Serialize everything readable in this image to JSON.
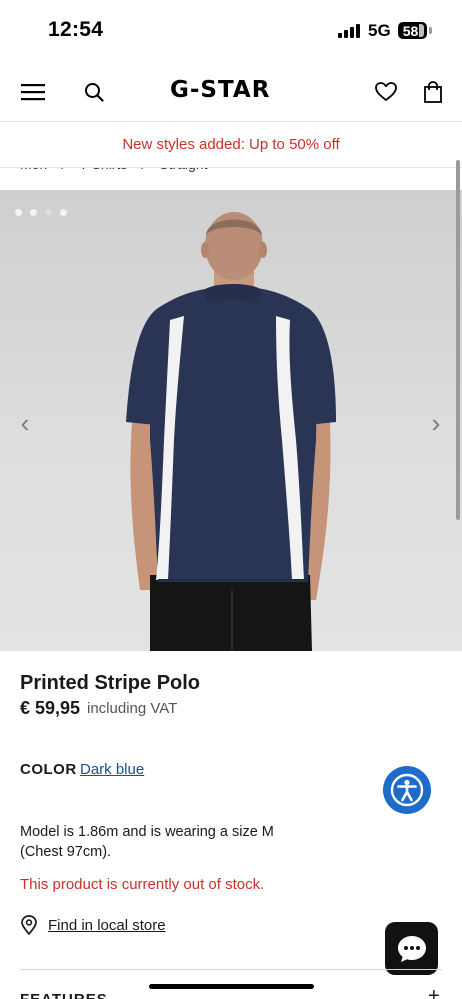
{
  "status_bar": {
    "time": "12:54",
    "network": "5G",
    "battery": "58"
  },
  "header": {
    "logo": "G-STAR",
    "icons": {
      "menu": "hamburger-menu-icon",
      "search": "search-icon",
      "wishlist": "heart-icon",
      "bag": "shopping-bag-icon"
    }
  },
  "promo": {
    "text": "New styles added: Up to 50% off",
    "color": "#c8322a"
  },
  "breadcrumb": {
    "items": [
      "Men",
      "T-Shirts",
      "Straight"
    ],
    "separator": "/"
  },
  "gallery": {
    "image_alt": "Model wearing Printed Stripe Polo, back view",
    "slide_count": 4,
    "active_slide": 3,
    "prev_arrow": "‹",
    "next_arrow": "›"
  },
  "product": {
    "name": "Printed Stripe Polo",
    "price": "€ 59,95",
    "vat_note": "including VAT",
    "color_label": "COLOR",
    "color_value": "Dark blue",
    "model_info": "Model is 1.86m and is wearing a size M (Chest 97cm).",
    "stock_status": "This product is currently out of stock.",
    "store_link": "Find in local store"
  },
  "features": {
    "label": "FEATURES",
    "expand": "+"
  },
  "colors": {
    "accent_red": "#c8322a",
    "link_blue": "#1f4e8c",
    "accessibility_blue": "#1e6bc9",
    "shirt_navy": "#2a3556"
  }
}
